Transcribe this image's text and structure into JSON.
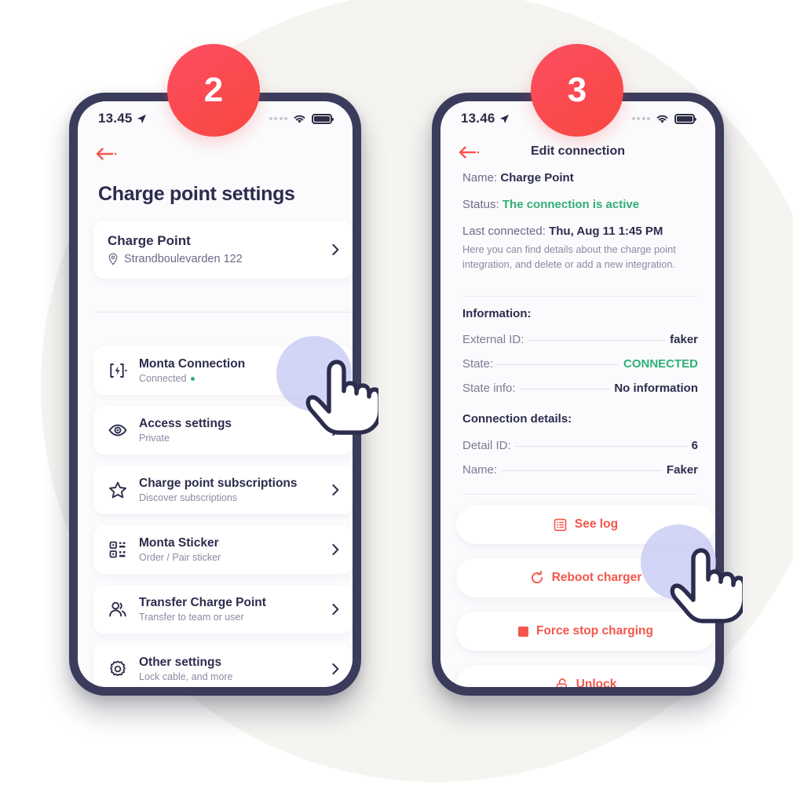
{
  "badges": {
    "step2": "2",
    "step3": "3"
  },
  "phone1": {
    "status": {
      "time": "13.45",
      "location_icon": "location-arrow-icon",
      "wifi_icon": "wifi-icon",
      "battery_icon": "battery-full-icon",
      "signal_icon": "signal-dots-icon"
    },
    "back_icon": "back-arrow-icon",
    "title": "Charge point settings",
    "charge_point_card": {
      "name": "Charge Point",
      "address": "Strandboulevarden 122",
      "pin_icon": "map-pin-icon",
      "chevron_icon": "chevron-right-icon"
    },
    "rows": [
      {
        "icon": "charge-bolt-icon",
        "title": "Monta Connection",
        "subtitle": "Connected",
        "status_dot": true,
        "chevron_icon": "chevron-right-icon"
      },
      {
        "icon": "eye-icon",
        "title": "Access settings",
        "subtitle": "Private",
        "status_dot": false,
        "chevron_icon": "chevron-right-icon"
      },
      {
        "icon": "star-icon",
        "title": "Charge point subscriptions",
        "subtitle": "Discover subscriptions",
        "status_dot": false,
        "chevron_icon": "chevron-right-icon"
      },
      {
        "icon": "qr-code-icon",
        "title": "Monta Sticker",
        "subtitle": "Order / Pair sticker",
        "status_dot": false,
        "chevron_icon": "chevron-right-icon"
      },
      {
        "icon": "users-icon",
        "title": "Transfer Charge Point",
        "subtitle": "Transfer to team or user",
        "status_dot": false,
        "chevron_icon": "chevron-right-icon"
      },
      {
        "icon": "gear-icon",
        "title": "Other settings",
        "subtitle": "Lock cable, and more",
        "status_dot": false,
        "chevron_icon": "chevron-right-icon"
      }
    ]
  },
  "phone2": {
    "status": {
      "time": "13.46",
      "location_icon": "location-arrow-icon",
      "wifi_icon": "wifi-icon",
      "battery_icon": "battery-full-icon",
      "signal_icon": "signal-dots-icon"
    },
    "back_icon": "back-arrow-icon",
    "title": "Edit connection",
    "summary": {
      "name_label": "Name:",
      "name_value": "Charge Point",
      "status_label": "Status:",
      "status_value": "The connection is active",
      "last_connected_label": "Last connected:",
      "last_connected_value": "Thu, Aug 11 1:45 PM",
      "description": "Here you can find details about the charge point integration, and delete or add a new integration."
    },
    "information": {
      "heading": "Information:",
      "rows": [
        {
          "label": "External ID:",
          "value": "faker",
          "green": false
        },
        {
          "label": "State:",
          "value": "CONNECTED",
          "green": true
        },
        {
          "label": "State info:",
          "value": "No information",
          "green": false
        }
      ]
    },
    "connection_details": {
      "heading": "Connection details:",
      "rows": [
        {
          "label": "Detail ID:",
          "value": "6",
          "green": false
        },
        {
          "label": "Name:",
          "value": "Faker",
          "green": false
        }
      ]
    },
    "actions": [
      {
        "icon": "list-log-icon",
        "label": "See log"
      },
      {
        "icon": "refresh-icon",
        "label": "Reboot charger"
      },
      {
        "icon": "stop-square-icon",
        "label": "Force stop charging"
      },
      {
        "icon": "unlock-icon",
        "label": "Unlock"
      }
    ]
  },
  "cursors": {
    "one": "hand-pointer-cursor",
    "two": "hand-pointer-cursor"
  },
  "colors": {
    "accent_red": "#f4564c",
    "badge_red": "#fb4a52",
    "navy": "#2c2c4e",
    "frame": "#3b3b5c",
    "green": "#2fae74",
    "bg_circle": "#f5f4f1",
    "halo": "#c3c7f2"
  }
}
